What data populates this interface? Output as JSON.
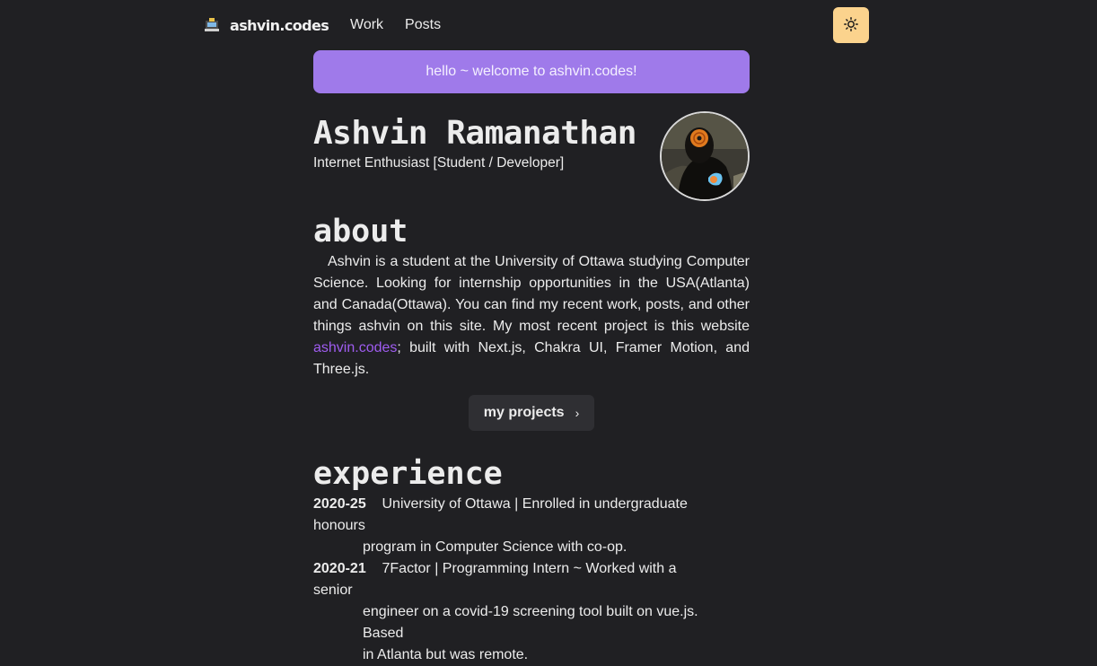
{
  "nav": {
    "logo_text": "ashvin.codes",
    "links": [
      "Work",
      "Posts"
    ],
    "theme_toggle_icon": "sun-icon"
  },
  "banner": {
    "text": "hello ~ welcome to ashvin.codes!"
  },
  "hero": {
    "name": "Ashvin Ramanathan",
    "tagline": "Internet Enthusiast [Student / Developer]"
  },
  "about": {
    "title": "about",
    "text_before_link": "Ashvin is a student at the University of Ottawa studying Computer Science. Looking for internship opportunities in the USA(Atlanta) and Canada(Ottawa). You can find my recent work, posts, and other things ashvin on this site. My most recent project is this website ",
    "link_text": "ashvin.codes",
    "text_after_link": "; built with Next.js, Chakra UI, Framer Motion, and Three.js.",
    "button_label": "my projects"
  },
  "experience": {
    "title": "experience",
    "items": [
      {
        "year": "2020-25",
        "line1": "University of Ottawa | Enrolled in undergraduate honours",
        "line2": "program in Computer Science with co-op."
      },
      {
        "year": "2020-21",
        "line1": "7Factor | Programming Intern ~ Worked with a senior",
        "line2": "engineer on a covid-19 screening tool built on vue.js. Based",
        "line3": "in Atlanta but was remote."
      }
    ]
  },
  "colors": {
    "background": "#202023",
    "banner": "#9f7aea",
    "accent_link": "#9f5cf0",
    "toggle": "#fbd38d"
  }
}
